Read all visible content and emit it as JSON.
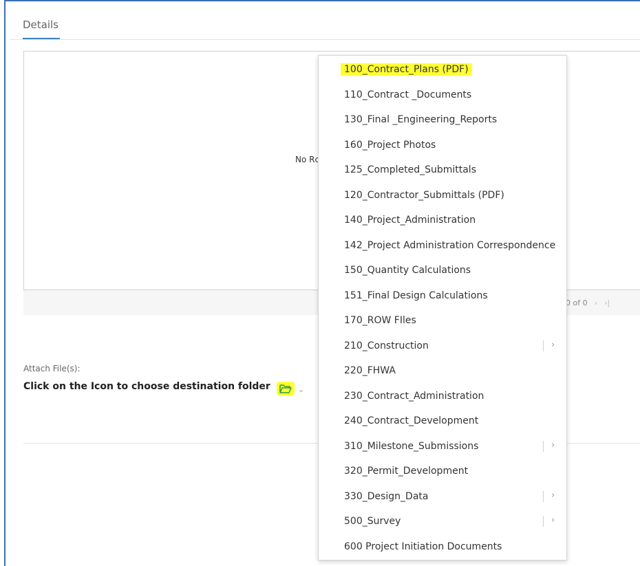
{
  "tabs": {
    "details": "Details"
  },
  "grid": {
    "empty_text": "No Rc",
    "pager_text": "0 of 0",
    "pager_next": "›",
    "pager_last": "›|"
  },
  "attach": {
    "label": "Attach File(s):",
    "instruction": "Click on the Icon to choose destination folder",
    "chevron": "⌄"
  },
  "folders": [
    {
      "label": "100_Contract_Plans (PDF)",
      "highlighted": true,
      "has_submenu": false
    },
    {
      "label": "110_Contract _Documents",
      "highlighted": false,
      "has_submenu": false
    },
    {
      "label": "130_Final _Engineering_Reports",
      "highlighted": false,
      "has_submenu": false
    },
    {
      "label": "160_Project Photos",
      "highlighted": false,
      "has_submenu": false
    },
    {
      "label": "125_Completed_Submittals",
      "highlighted": false,
      "has_submenu": false
    },
    {
      "label": "120_Contractor_Submittals (PDF)",
      "highlighted": false,
      "has_submenu": false
    },
    {
      "label": "140_Project_Administration",
      "highlighted": false,
      "has_submenu": false
    },
    {
      "label": "142_Project Administration Correspondence",
      "highlighted": false,
      "has_submenu": false
    },
    {
      "label": "150_Quantity Calculations",
      "highlighted": false,
      "has_submenu": false
    },
    {
      "label": "151_Final Design Calculations",
      "highlighted": false,
      "has_submenu": false
    },
    {
      "label": "170_ROW FIles",
      "highlighted": false,
      "has_submenu": false
    },
    {
      "label": "210_Construction",
      "highlighted": false,
      "has_submenu": true
    },
    {
      "label": "220_FHWA",
      "highlighted": false,
      "has_submenu": false
    },
    {
      "label": "230_Contract_Administration",
      "highlighted": false,
      "has_submenu": false
    },
    {
      "label": "240_Contract_Development",
      "highlighted": false,
      "has_submenu": false
    },
    {
      "label": "310_Milestone_Submissions",
      "highlighted": false,
      "has_submenu": true
    },
    {
      "label": "320_Permit_Development",
      "highlighted": false,
      "has_submenu": false
    },
    {
      "label": "330_Design_Data",
      "highlighted": false,
      "has_submenu": true
    },
    {
      "label": "500_Survey",
      "highlighted": false,
      "has_submenu": true
    },
    {
      "label": "600 Project Initiation Documents",
      "highlighted": false,
      "has_submenu": false
    }
  ],
  "submenu_arrow": "›",
  "colors": {
    "highlight": "#ffff33",
    "accent": "#3d82c4",
    "frame": "#3b6fb6"
  },
  "icons": {
    "folder": "folder-open-icon",
    "chevron": "chevron-down-icon",
    "submenu": "chevron-right-icon"
  }
}
